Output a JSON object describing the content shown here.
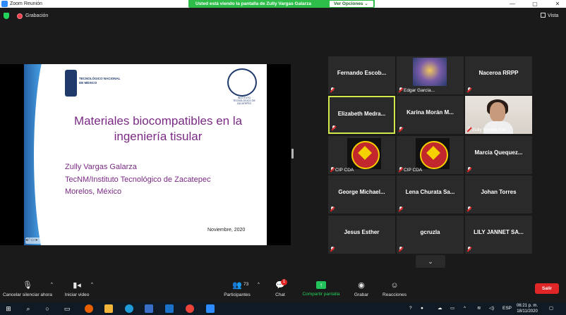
{
  "window": {
    "title": "Zoom Reunión",
    "controls": {
      "minimize": "—",
      "maximize": "▢",
      "close": "✕"
    }
  },
  "share_banner": {
    "message": "Usted está viendo la pantalla de Zully Vargas Galarza",
    "options": "Ver Opciones ⌄"
  },
  "top": {
    "recording_label": "Grabación",
    "view_label": "Vista"
  },
  "slide": {
    "institution_left": "TECNOLÓGICO NACIONAL DE MÉXICO",
    "institution_right": "INSTITUTO TECNOLÓGICO DE ZACATEPEC",
    "title": "Materiales biocompatibles en la ingeniería tisular",
    "author_lines": [
      "Zully Vargas Galarza",
      "TecNM/Instituto Tecnológico de Zacatepec",
      "Morelos, México"
    ],
    "date": "Noviembre, 2020",
    "toolbar": "◂ ⁄ ▭ ▸"
  },
  "participants": [
    {
      "name": "Fernando Escob...",
      "label": "",
      "kind": "name",
      "active": false
    },
    {
      "name": "",
      "label": "Edgar García...",
      "kind": "photo",
      "active": false
    },
    {
      "name": "Naceroa RRPP",
      "label": "",
      "kind": "name",
      "active": false
    },
    {
      "name": "Elizabeth Medra...",
      "label": "",
      "kind": "name",
      "active": true
    },
    {
      "name": "Karina Morán M...",
      "label": "",
      "kind": "name",
      "active": false
    },
    {
      "name": "",
      "label": "Zully Vargas Gal...",
      "kind": "video",
      "active": false
    },
    {
      "name": "",
      "label": "CIP CDA",
      "kind": "logo",
      "active": false
    },
    {
      "name": "",
      "label": "CIP CDA",
      "kind": "logo",
      "active": false
    },
    {
      "name": "Marcia Quequez...",
      "label": "",
      "kind": "name",
      "active": false
    },
    {
      "name": "George Michael...",
      "label": "",
      "kind": "name",
      "active": false
    },
    {
      "name": "Lena Churata Sa...",
      "label": "",
      "kind": "name",
      "active": false
    },
    {
      "name": "Johan Torres",
      "label": "",
      "kind": "name",
      "active": false
    },
    {
      "name": "Jesus Esther",
      "label": "",
      "kind": "name",
      "active": false
    },
    {
      "name": "gcruzla",
      "label": "",
      "kind": "name",
      "active": false
    },
    {
      "name": "LILY JANNET SA...",
      "label": "",
      "kind": "name",
      "active": false
    }
  ],
  "controls": {
    "mute": "Cancelar silenciar ahora",
    "video": "Iniciar video",
    "participants": "Participantes",
    "participants_count": "73",
    "chat": "Chat",
    "chat_badge": "1",
    "share": "Compartir pantalla",
    "record": "Grabar",
    "reactions": "Reacciones",
    "leave": "Salir"
  },
  "taskbar": {
    "language": "ESP",
    "time": "06:21 p. m.",
    "date": "18/11/2020"
  }
}
